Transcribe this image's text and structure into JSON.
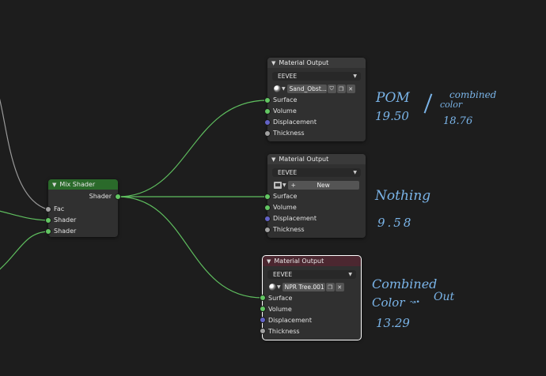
{
  "colors": {
    "background": "#1d1d1d",
    "node_body": "#303030",
    "mix_header": "#2a6a2a",
    "output_header": "#3a3a3a",
    "output_header_active": "#4c2730",
    "shader_socket": "#63c763",
    "vector_socket": "#6363c7",
    "float_socket": "#a1a1a1",
    "wire_green": "#5fbf5f",
    "wire_gray": "#9a9a9a",
    "annotation": "#7ab4e8"
  },
  "mix_node": {
    "title": "Mix Shader",
    "output": "Shader",
    "inputs": [
      "Fac",
      "Shader",
      "Shader"
    ]
  },
  "output_nodes": [
    {
      "title": "Material Output",
      "target": "EEVEE",
      "material": "Sand_Obst...",
      "sockets": [
        "Surface",
        "Volume",
        "Displacement",
        "Thickness"
      ]
    },
    {
      "title": "Material Output",
      "target": "EEVEE",
      "new_label": "New",
      "sockets": [
        "Surface",
        "Volume",
        "Displacement",
        "Thickness"
      ]
    },
    {
      "title": "Material Output",
      "target": "EEVEE",
      "material": "NPR Tree.001",
      "sockets": [
        "Surface",
        "Volume",
        "Displacement",
        "Thickness"
      ]
    }
  ],
  "annotations": {
    "pom_label": "POM",
    "pom_value": "19.50",
    "combined_label_1": "combined",
    "combined_label_2": "color",
    "combined_value": "18.76",
    "nothing_label": "Nothing",
    "nothing_value": "9.58",
    "combined_color_label_1": "Combined",
    "combined_color_label_2": "Color",
    "out_label": "Out",
    "combined_color_value": "13.29"
  },
  "icons": {
    "collapse": "chevron-down-icon",
    "dropdown": "chevron-down-icon",
    "material": "material-sphere-icon",
    "browse": "browse-material-icon",
    "fake_user": "shield-icon",
    "duplicate": "duplicate-icon",
    "unlink": "close-icon",
    "new": "plus-icon"
  }
}
